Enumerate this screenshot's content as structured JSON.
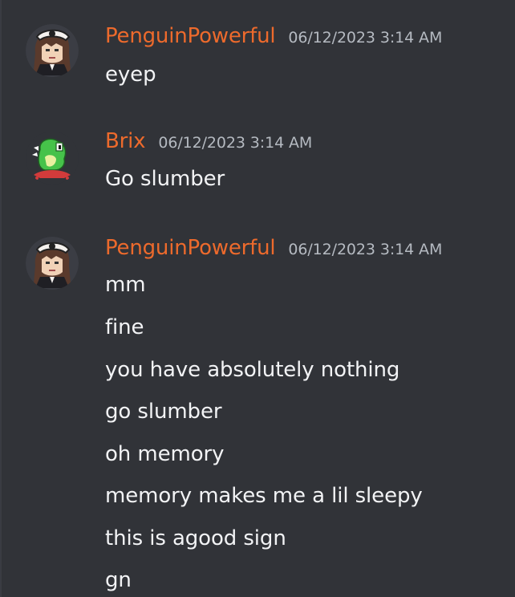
{
  "colors": {
    "background": "#313338",
    "username": "#ed6a2c",
    "timestamp": "#b5bac1",
    "message_text": "#f2f3f5"
  },
  "messages": [
    {
      "avatar_icon": "penguinpowerful-avatar-icon",
      "username": "PenguinPowerful",
      "timestamp": "06/12/2023 3:14 AM",
      "lines": [
        "eyep"
      ]
    },
    {
      "avatar_icon": "brix-avatar-icon",
      "username": "Brix",
      "timestamp": "06/12/2023 3:14 AM",
      "lines": [
        "Go slumber"
      ]
    },
    {
      "avatar_icon": "penguinpowerful-avatar-icon",
      "username": "PenguinPowerful",
      "timestamp": "06/12/2023 3:14 AM",
      "lines": [
        "mm",
        "fine",
        "you have absolutely nothing",
        "go slumber",
        "oh memory",
        "memory makes me a lil sleepy",
        "this is agood sign",
        "gn"
      ]
    }
  ]
}
